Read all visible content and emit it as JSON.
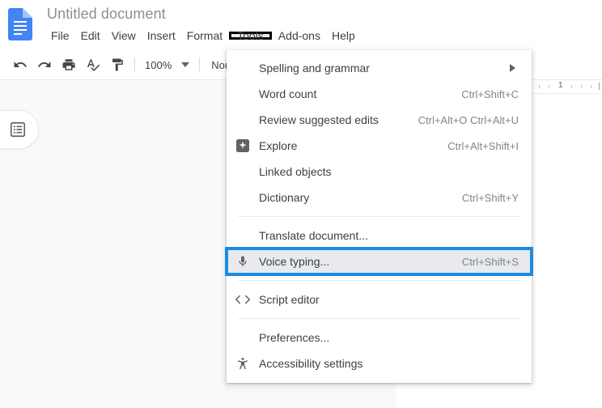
{
  "app": {
    "doc_title": "Untitled document",
    "logo_icon": "google-docs-icon",
    "logo_color": "#4285f4"
  },
  "menubar": {
    "items": [
      {
        "label": "File",
        "icon": "",
        "active": false
      },
      {
        "label": "Edit",
        "icon": "",
        "active": false
      },
      {
        "label": "View",
        "icon": "",
        "active": false
      },
      {
        "label": "Insert",
        "icon": "",
        "active": false
      },
      {
        "label": "Format",
        "icon": "",
        "active": false
      },
      {
        "label": "Tools",
        "icon": "",
        "active": true
      },
      {
        "label": "Add-ons",
        "icon": "",
        "active": false
      },
      {
        "label": "Help",
        "icon": "",
        "active": false
      }
    ],
    "annotation_color": "#000000"
  },
  "toolbar": {
    "buttons": [
      {
        "name": "undo-icon",
        "title": "Undo"
      },
      {
        "name": "redo-icon",
        "title": "Redo"
      },
      {
        "name": "print-icon",
        "title": "Print"
      },
      {
        "name": "spellcheck-icon",
        "title": "Spelling and grammar check"
      },
      {
        "name": "paint-format-icon",
        "title": "Paint format"
      }
    ],
    "zoom_value": "100%",
    "style_value": "Normal"
  },
  "ruler": {
    "number_label": "1"
  },
  "canvas": {
    "outline_toggle_icon": "document-outline-icon"
  },
  "tools_menu": {
    "items": [
      {
        "type": "item",
        "label": "Spelling and grammar",
        "accel": "",
        "icon": "",
        "submenu": true,
        "highlighted": false
      },
      {
        "type": "item",
        "label": "Word count",
        "accel": "Ctrl+Shift+C",
        "icon": "",
        "submenu": false,
        "highlighted": false
      },
      {
        "type": "item",
        "label": "Review suggested edits",
        "accel": "Ctrl+Alt+O Ctrl+Alt+U",
        "icon": "",
        "submenu": false,
        "highlighted": false
      },
      {
        "type": "item",
        "label": "Explore",
        "accel": "Ctrl+Alt+Shift+I",
        "icon": "explore-icon",
        "submenu": false,
        "highlighted": false
      },
      {
        "type": "item",
        "label": "Linked objects",
        "accel": "",
        "icon": "",
        "submenu": false,
        "highlighted": false
      },
      {
        "type": "item",
        "label": "Dictionary",
        "accel": "Ctrl+Shift+Y",
        "icon": "",
        "submenu": false,
        "highlighted": false
      },
      {
        "type": "separator"
      },
      {
        "type": "item",
        "label": "Translate document...",
        "accel": "",
        "icon": "",
        "submenu": false,
        "highlighted": false
      },
      {
        "type": "item",
        "label": "Voice typing...",
        "accel": "Ctrl+Shift+S",
        "icon": "microphone-icon",
        "submenu": false,
        "highlighted": true
      },
      {
        "type": "separator"
      },
      {
        "type": "item",
        "label": "Script editor",
        "accel": "",
        "icon": "code-brackets-icon",
        "submenu": false,
        "highlighted": false
      },
      {
        "type": "separator"
      },
      {
        "type": "item",
        "label": "Preferences...",
        "accel": "",
        "icon": "",
        "submenu": false,
        "highlighted": false
      },
      {
        "type": "item",
        "label": "Accessibility settings",
        "accel": "",
        "icon": "accessibility-icon",
        "submenu": false,
        "highlighted": false
      }
    ],
    "highlight_border_color": "#1a8ce5",
    "highlight_bg_color": "#e8eaed"
  }
}
